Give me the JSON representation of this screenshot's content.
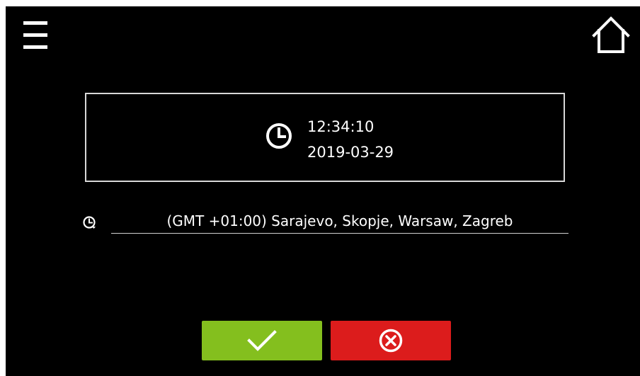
{
  "header": {
    "menu_icon": "hamburger-menu-icon",
    "home_icon": "home-icon"
  },
  "datetime": {
    "icon": "clock-icon",
    "time": "12:34:10",
    "date": "2019-03-29"
  },
  "timezone": {
    "icon": "timezone-clock-icon",
    "value": "(GMT +01:00) Sarajevo, Skopje, Warsaw, Zagreb"
  },
  "actions": {
    "confirm_icon": "checkmark-icon",
    "cancel_icon": "cancel-circle-x-icon"
  },
  "colors": {
    "background": "#000000",
    "confirm": "#84bf1e",
    "cancel": "#dc1c1c",
    "text": "#ffffff"
  }
}
